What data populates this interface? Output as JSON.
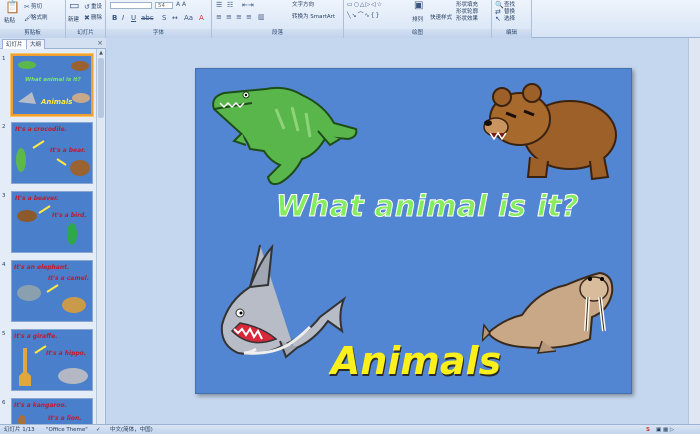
{
  "ribbon": {
    "clipboard": {
      "paste": "粘贴",
      "cut": "剪切",
      "format_painter": "格式刷",
      "label": "剪贴板"
    },
    "slides": {
      "new_slide": "新建",
      "reset": "重设",
      "delete": "删除",
      "label": "幻灯片"
    },
    "font": {
      "size": "54",
      "label": "字体"
    },
    "paragraph": {
      "label": "段落",
      "text_direction": "文字方向",
      "convert": "转换为 SmartArt"
    },
    "drawing": {
      "arrange": "排列",
      "quick_styles": "快速样式",
      "shape_fill": "形状填充",
      "shape_outline": "形状轮廓",
      "shape_effects": "形状效果",
      "label": "绘图"
    },
    "editing": {
      "find": "查找",
      "replace": "替换",
      "select": "选择",
      "label": "编辑"
    }
  },
  "panel": {
    "tab_slides": "幻灯片",
    "tab_outline": "大纲",
    "close": "×",
    "thumbnails": [
      {
        "num": "1",
        "line1": "What animal is it?",
        "line2": "Animals"
      },
      {
        "num": "2",
        "line1": "It's a crocodile.",
        "line2": "It's a bear."
      },
      {
        "num": "3",
        "line1": "It's a beaver.",
        "line2": "It's a bird."
      },
      {
        "num": "4",
        "line1": "It's an elephant.",
        "line2": "It's a camel."
      },
      {
        "num": "5",
        "line1": "It's a giraffe.",
        "line2": "It's a hippo."
      },
      {
        "num": "6",
        "line1": "It's a kangaroo.",
        "line2": "It's a lion."
      }
    ]
  },
  "slide": {
    "title": "What animal is it?",
    "subtitle": "Animals"
  },
  "status": {
    "slide_counter": "幻灯片 1/13",
    "theme": "\"Office Theme\"",
    "language": "中文(简体，中国)"
  },
  "colors": {
    "slide_bg": "#5286d2",
    "title_green": "#86ec5e",
    "subtitle_yellow": "#fbef1c",
    "selection_orange": "#f0a030",
    "thumb_red_text": "#c21a2e"
  }
}
